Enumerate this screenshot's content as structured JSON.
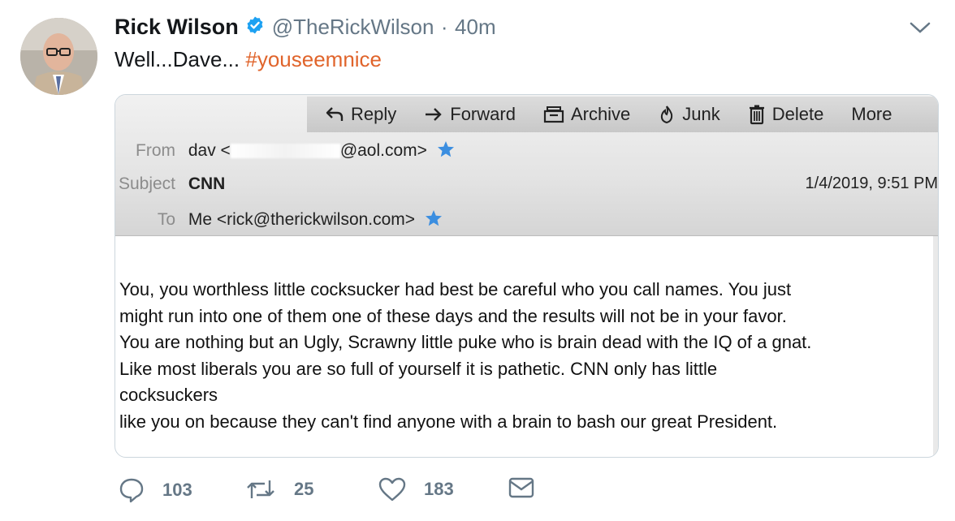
{
  "tweet": {
    "author_name": "Rick Wilson",
    "handle": "@TheRickWilson",
    "separator": "·",
    "time": "40m",
    "text": "Well...Dave...",
    "hashtag": "#youseemnice"
  },
  "email": {
    "toolbar": {
      "reply": "Reply",
      "forward": "Forward",
      "archive": "Archive",
      "junk": "Junk",
      "delete": "Delete",
      "more": "More"
    },
    "from_label": "From",
    "from_name": "dav <",
    "from_domain": "@aol.com>",
    "subject_label": "Subject",
    "subject": "CNN",
    "date": "1/4/2019, 9:51 PM",
    "to_label": "To",
    "to_value": "Me <rick@therickwilson.com>",
    "body_lines": [
      "You, you worthless little cocksucker had best be careful who you call names.  You just",
      "might run into one of them one of these days and the results will not be in your favor.",
      "You are nothing but an Ugly, Scrawny little puke who is brain dead with the IQ of a gnat.",
      "Like most liberals you are so full of yourself it is pathetic.  CNN only has little",
      "cocksuckers",
      "like you on because they can't find anyone with a brain to bash our great President."
    ]
  },
  "actions": {
    "replies": "103",
    "retweets": "25",
    "likes": "183"
  },
  "colors": {
    "hashtag": "#e0642b",
    "verified": "#1da1f2",
    "action_gray": "#657786"
  }
}
